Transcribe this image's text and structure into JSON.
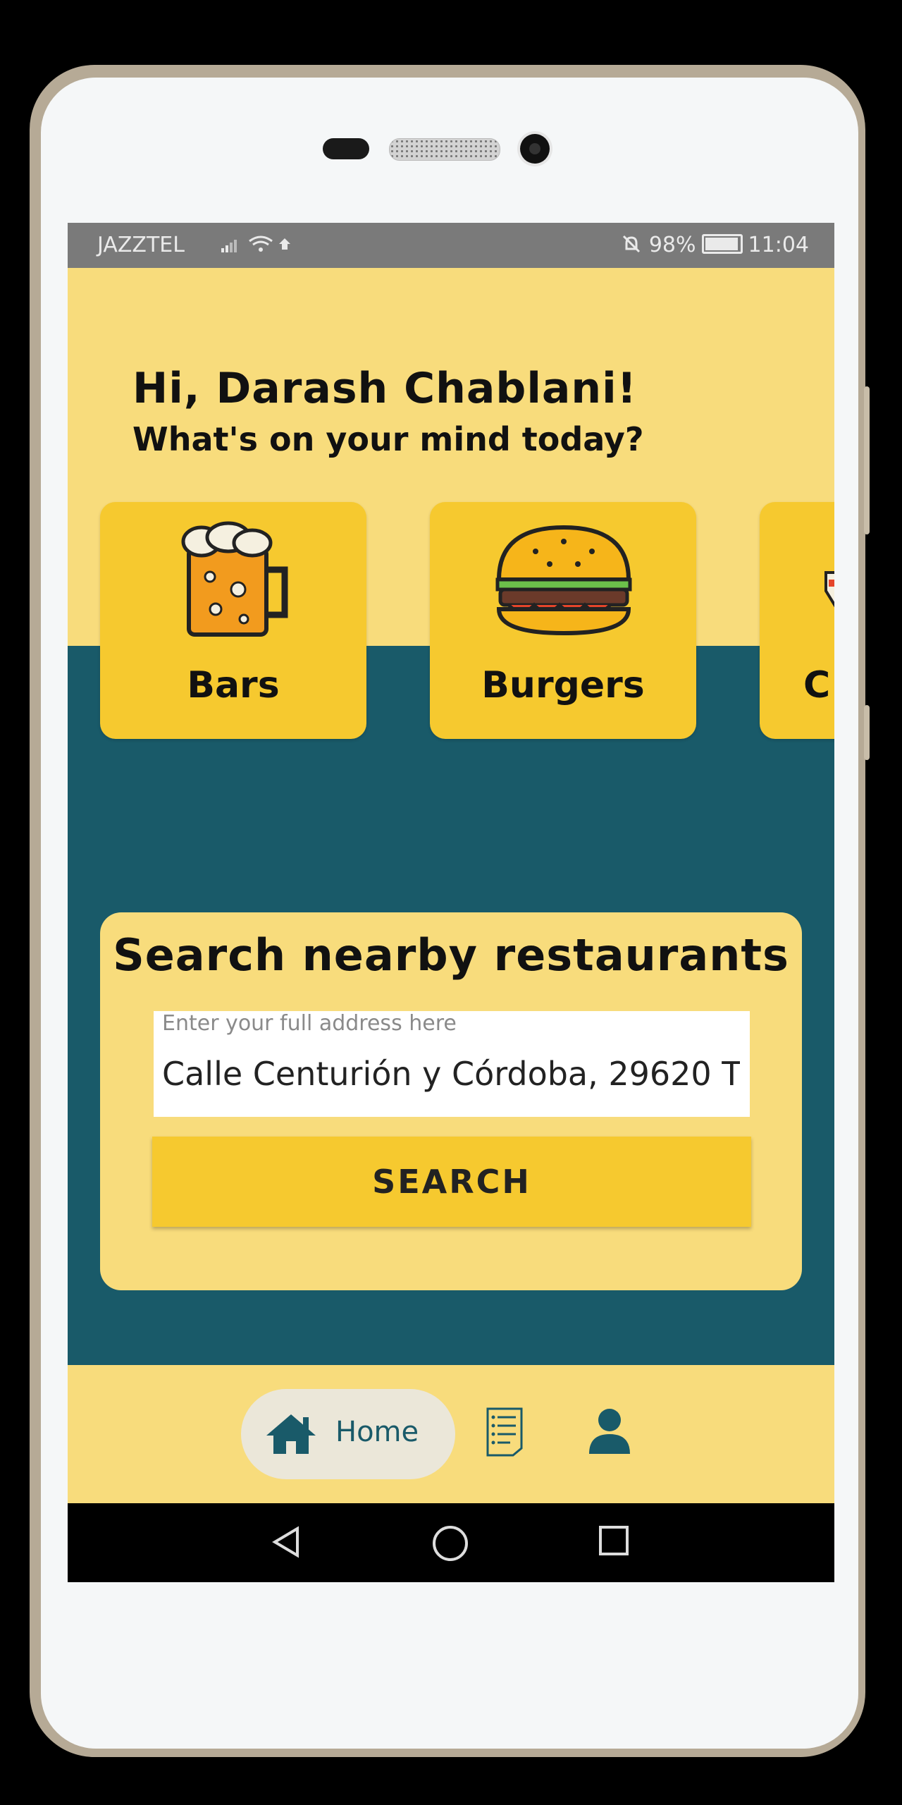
{
  "status_bar": {
    "carrier": "JAZZTEL",
    "battery": "98%",
    "time": "11:04"
  },
  "greeting": {
    "title": "Hi, Darash Chablani!",
    "subtitle": "What's on your mind today?"
  },
  "categories": [
    {
      "label": "Bars",
      "icon": "beer-mug-icon"
    },
    {
      "label": "Burgers",
      "icon": "burger-icon"
    },
    {
      "label": "C",
      "icon": "partial-icon"
    }
  ],
  "search": {
    "title": "Search nearby restaurants",
    "placeholder": "Enter your full address here",
    "value": "Calle Centurión y Córdoba, 29620 T",
    "button_label": "SEARCH"
  },
  "bottom_nav": {
    "home_label": "Home",
    "items": [
      "home-icon",
      "orders-icon",
      "profile-icon"
    ]
  },
  "colors": {
    "yellow_bg": "#f8dc7c",
    "card_yellow": "#f6c92f",
    "teal": "#195a69"
  }
}
